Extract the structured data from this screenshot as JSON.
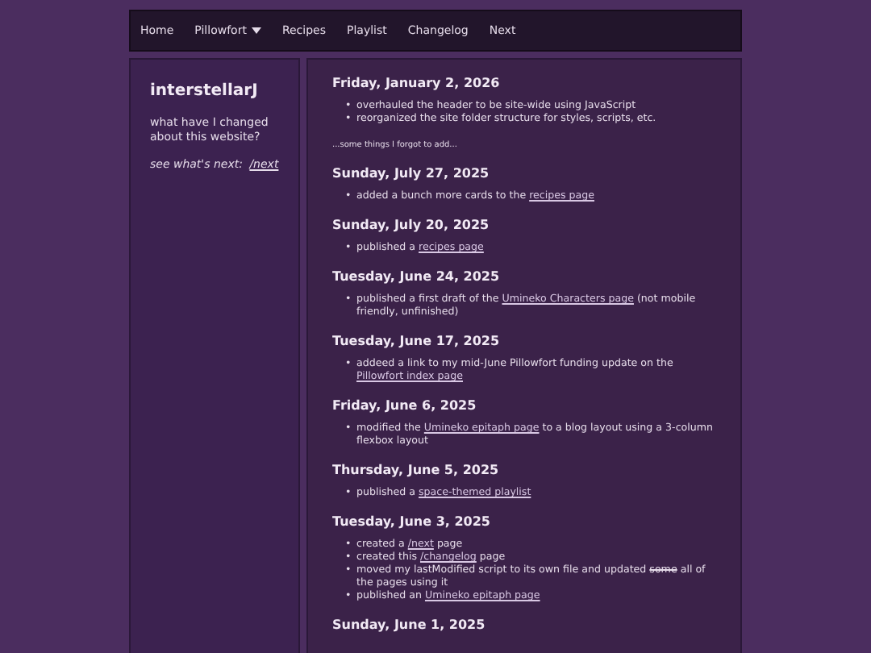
{
  "nav": [
    {
      "label": "Home",
      "dropdown": false
    },
    {
      "label": "Pillowfort",
      "dropdown": true
    },
    {
      "label": "Recipes",
      "dropdown": false
    },
    {
      "label": "Playlist",
      "dropdown": false
    },
    {
      "label": "Changelog",
      "dropdown": false
    },
    {
      "label": "Next",
      "dropdown": false
    }
  ],
  "sidebar": {
    "title": "interstellarJ",
    "description": "what have I changed about this website?",
    "next_prompt": "see what's next:",
    "next_link": "/next"
  },
  "bullet": "•",
  "entries": [
    {
      "kind": "day",
      "date": "Friday, January 2, 2026",
      "items": [
        [
          {
            "kind": "plain",
            "text": "overhauled the header to be site-wide using JavaScript"
          }
        ],
        [
          {
            "kind": "plain",
            "text": "reorganized the site folder structure for styles, scripts, etc."
          }
        ]
      ]
    },
    {
      "kind": "note",
      "text": "...some things I forgot to add..."
    },
    {
      "kind": "day",
      "date": "Sunday, July 27, 2025",
      "items": [
        [
          {
            "kind": "plain",
            "text": "added a bunch more cards to the "
          },
          {
            "kind": "link",
            "text": "recipes page"
          }
        ]
      ]
    },
    {
      "kind": "day",
      "date": "Sunday, July 20, 2025",
      "items": [
        [
          {
            "kind": "plain",
            "text": "published a "
          },
          {
            "kind": "link",
            "text": "recipes page"
          }
        ]
      ]
    },
    {
      "kind": "day",
      "date": "Tuesday, June 24, 2025",
      "items": [
        [
          {
            "kind": "plain",
            "text": "published a first draft of the "
          },
          {
            "kind": "link",
            "text": "Umineko Characters page"
          },
          {
            "kind": "plain",
            "text": " (not mobile friendly, unfinished)"
          }
        ]
      ]
    },
    {
      "kind": "day",
      "date": "Tuesday, June 17, 2025",
      "items": [
        [
          {
            "kind": "plain",
            "text": "addeed a link to my mid-June Pillowfort funding update on the "
          },
          {
            "kind": "link",
            "text": "Pillowfort index page"
          }
        ]
      ]
    },
    {
      "kind": "day",
      "date": "Friday, June 6, 2025",
      "items": [
        [
          {
            "kind": "plain",
            "text": "modified the "
          },
          {
            "kind": "link",
            "text": "Umineko epitaph page"
          },
          {
            "kind": "plain",
            "text": " to a blog layout using a 3-column flexbox layout"
          }
        ]
      ]
    },
    {
      "kind": "day",
      "date": "Thursday, June 5, 2025",
      "items": [
        [
          {
            "kind": "plain",
            "text": "published a "
          },
          {
            "kind": "link",
            "text": "space-themed playlist"
          }
        ]
      ]
    },
    {
      "kind": "day",
      "date": "Tuesday, June 3, 2025",
      "items": [
        [
          {
            "kind": "plain",
            "text": "created a "
          },
          {
            "kind": "link",
            "text": "/next"
          },
          {
            "kind": "plain",
            "text": " page"
          }
        ],
        [
          {
            "kind": "plain",
            "text": "created this "
          },
          {
            "kind": "link",
            "text": "/changelog"
          },
          {
            "kind": "plain",
            "text": " page"
          }
        ],
        [
          {
            "kind": "plain",
            "text": "moved my lastModified script to its own file and updated "
          },
          {
            "kind": "strike",
            "text": "some"
          },
          {
            "kind": "plain",
            "text": " all of the pages using it"
          }
        ],
        [
          {
            "kind": "plain",
            "text": "published an "
          },
          {
            "kind": "link",
            "text": "Umineko epitaph page"
          }
        ]
      ]
    },
    {
      "kind": "day",
      "date": "Sunday, June 1, 2025"
    }
  ]
}
